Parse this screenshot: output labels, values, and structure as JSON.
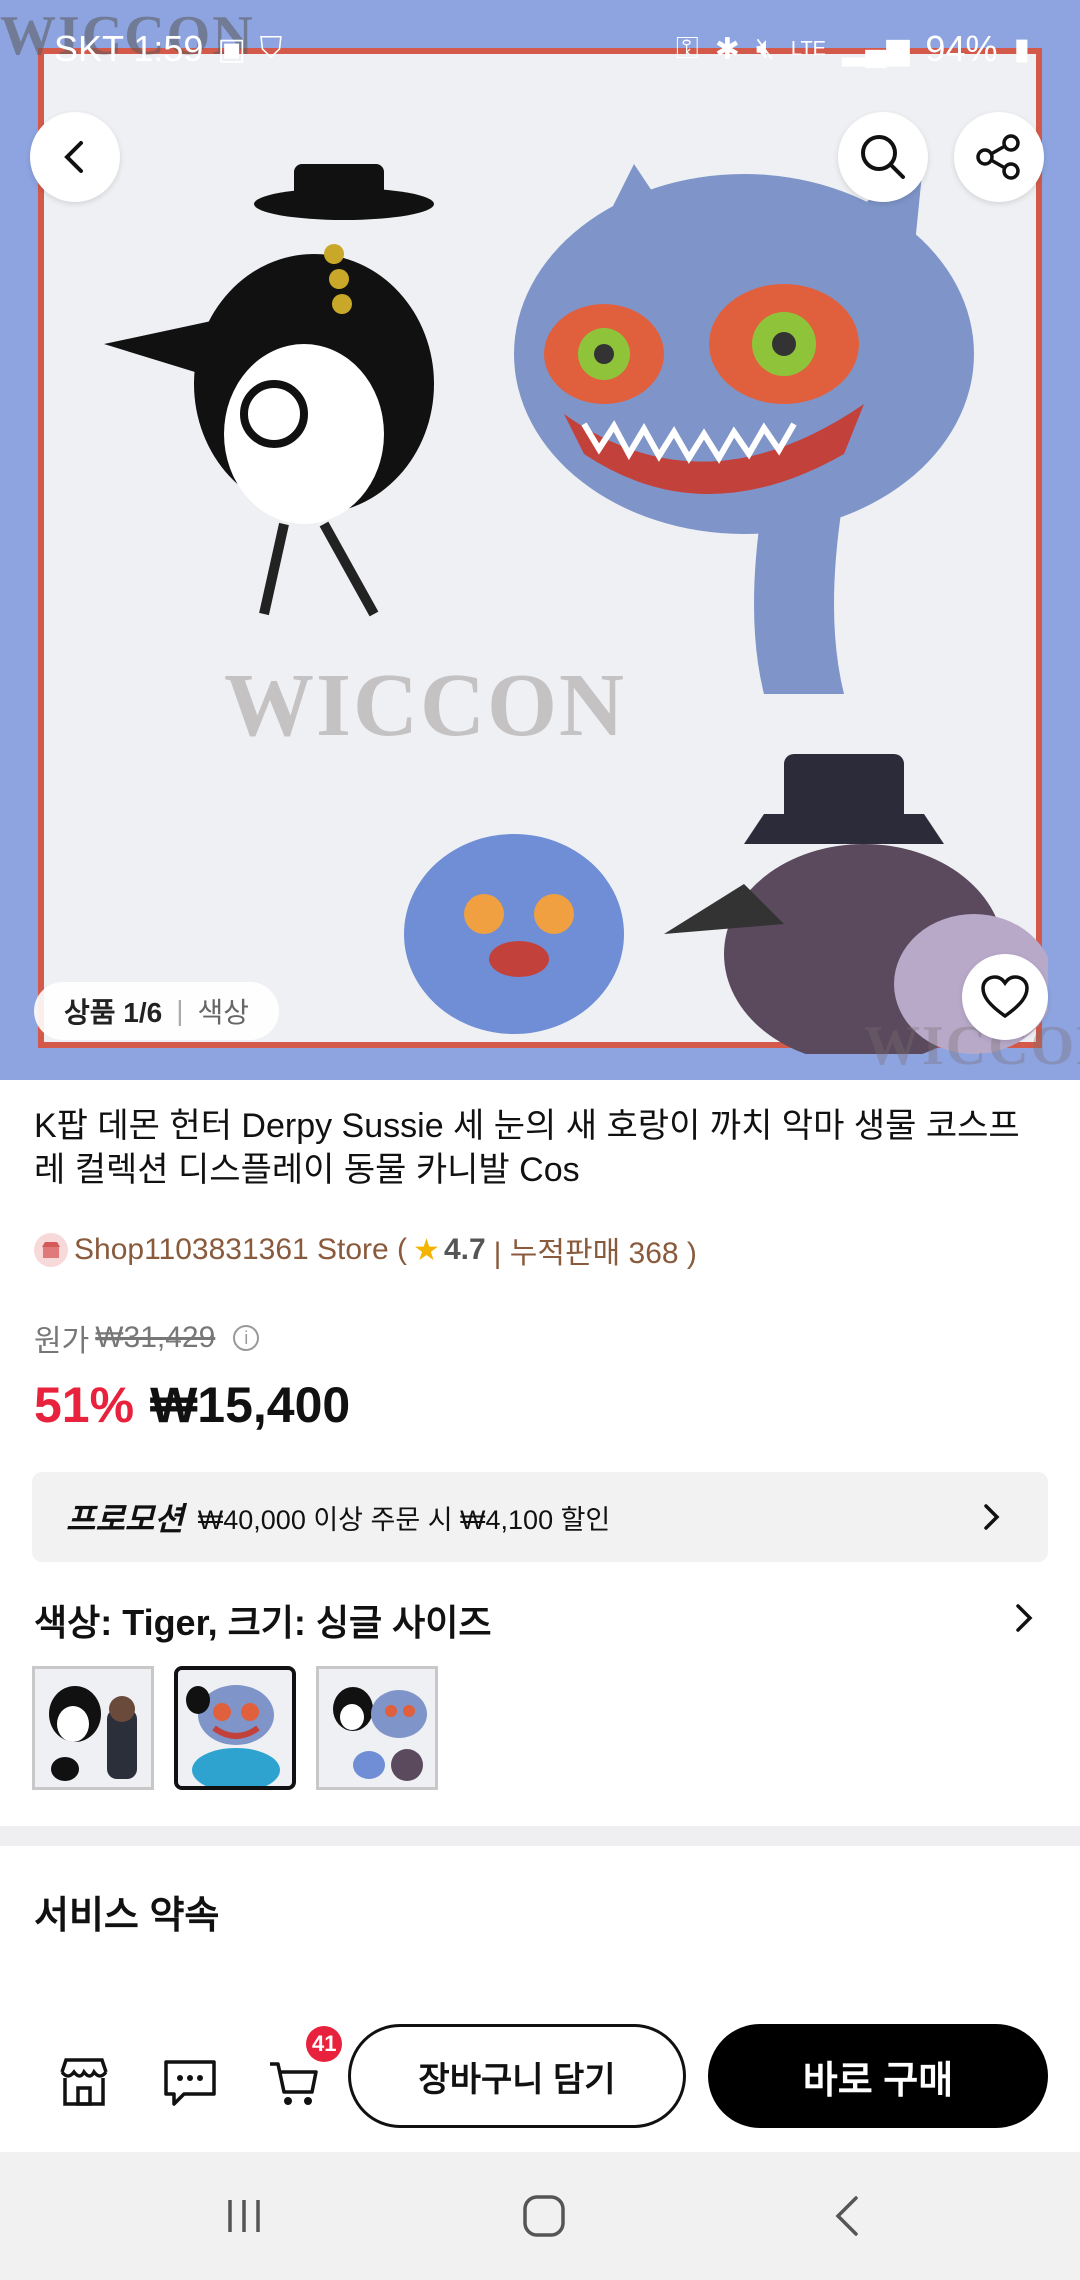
{
  "status_bar": {
    "carrier_time": "SKT 1:59",
    "network": "LTE",
    "battery": "94%"
  },
  "hero": {
    "watermark": "WICCON",
    "counter_main": "상품 1/6",
    "counter_sub": "색상"
  },
  "product": {
    "title": "K팝  데몬 헌터 Derpy Sussie 세 눈의 새 호랑이 까치 악마 생물 코스프레 컬렉션 디스플레이 동물 카니발 Cos",
    "store_name": "Shop1103831361 Store (",
    "rating": "4.7",
    "sales_text": "| 누적판매 368 )",
    "original_label": "원가",
    "original_price": "₩31,429",
    "discount": "51%",
    "price": "₩15,400"
  },
  "promotion": {
    "tag": "프로모션",
    "text": "₩40,000 이상 주문 시 ₩4,100 할인"
  },
  "options": {
    "label": "색상: Tiger, 크기: 싱글 사이즈",
    "selected_index": 1,
    "thumb_count": 3
  },
  "service": {
    "title": "서비스 약속"
  },
  "action_bar": {
    "cart_badge": "41",
    "add_to_cart": "장바구니 담기",
    "buy_now": "바로 구매"
  },
  "colors": {
    "accent_red": "#e8213c",
    "hero_bg": "#8ea4e0",
    "store_brown": "#8a5a3c"
  }
}
